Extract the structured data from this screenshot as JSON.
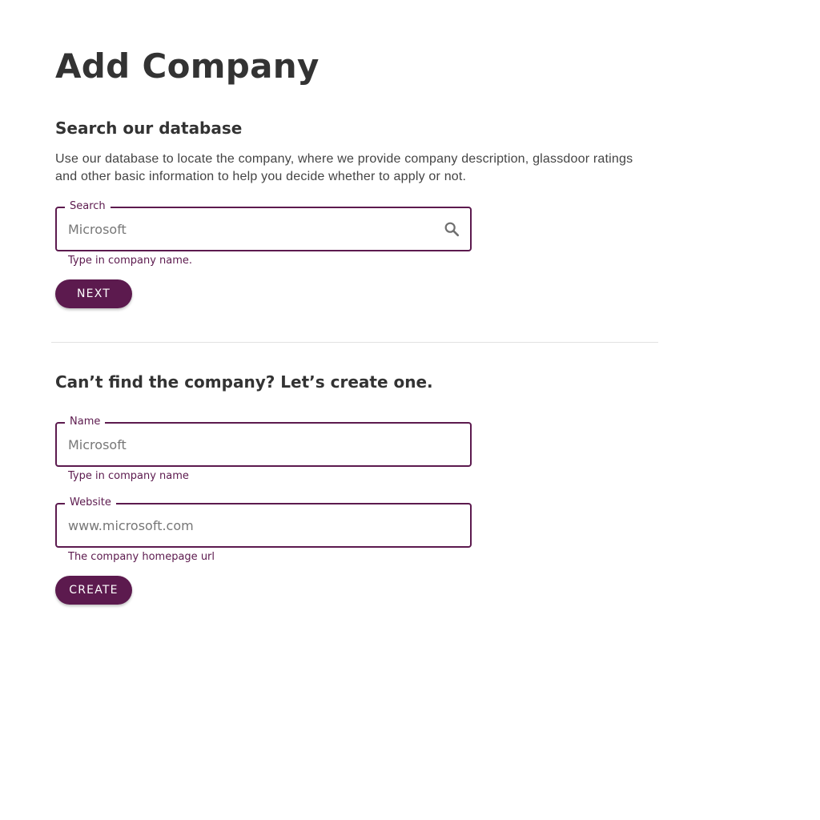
{
  "page": {
    "title": "Add Company"
  },
  "search_section": {
    "heading": "Search our database",
    "description": "Use our database to locate the company, where we provide company description, glassdoor ratings and other basic information to help you decide whether to apply or not.",
    "search_field": {
      "label": "Search",
      "placeholder": "Microsoft",
      "value": "",
      "helper": "Type in company name.",
      "icon": "search-icon"
    },
    "next_button_label": "NEXT"
  },
  "create_section": {
    "heading": "Can’t find the company? Let’s create one.",
    "name_field": {
      "label": "Name",
      "placeholder": "Microsoft",
      "value": "",
      "helper": "Type in company name"
    },
    "website_field": {
      "label": "Website",
      "placeholder": "www.microsoft.com",
      "value": "",
      "helper": "The company homepage url"
    },
    "create_button_label": "CREATE"
  },
  "colors": {
    "accent": "#5c1a4e",
    "text": "#333333",
    "divider": "#e2e2e2"
  }
}
